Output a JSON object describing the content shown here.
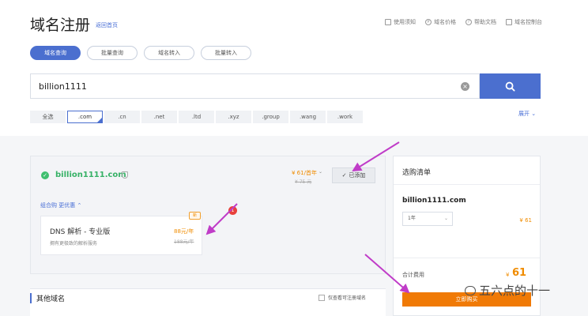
{
  "header": {
    "title": "域名注册",
    "home_link": "返回首页",
    "links": [
      "使用须知",
      "域名价格",
      "帮助文档",
      "域名控制台"
    ]
  },
  "tabs": [
    "域名查询",
    "批量查询",
    "域名转入",
    "批量转入"
  ],
  "search": {
    "value": "billion1111"
  },
  "suffixes": [
    "全选",
    ".com",
    ".cn",
    ".net",
    ".ltd",
    ".xyz",
    ".group",
    ".wang",
    ".work"
  ],
  "expand_label": "展开",
  "result": {
    "domain": "billion1111.com",
    "price": "¥ 61/首年",
    "old_price": "¥ 75 元",
    "added_label": "已添加",
    "combo_label": "组合购 更优惠",
    "dns": {
      "title": "DNS 解析 - 专业版",
      "desc": "拥有更极致的解析服务",
      "price": "88元/年",
      "old_price": "188元/年",
      "badge": "新"
    },
    "dot_count": "1"
  },
  "others": {
    "title": "其他域名",
    "filter_label": "仅查看可注册域名"
  },
  "cart": {
    "title": "选购清单",
    "domain": "billion1111.com",
    "year": "1年",
    "price": "¥ 61",
    "total_label": "合计费用",
    "total_symbol": "¥",
    "total": "61",
    "buy_label": "立即购买"
  },
  "watermark": "五六点的十一",
  "colors": {
    "accent": "#4b6fcf",
    "orange": "#f07a06",
    "arrow": "#c03cc8",
    "green": "#36b166"
  }
}
